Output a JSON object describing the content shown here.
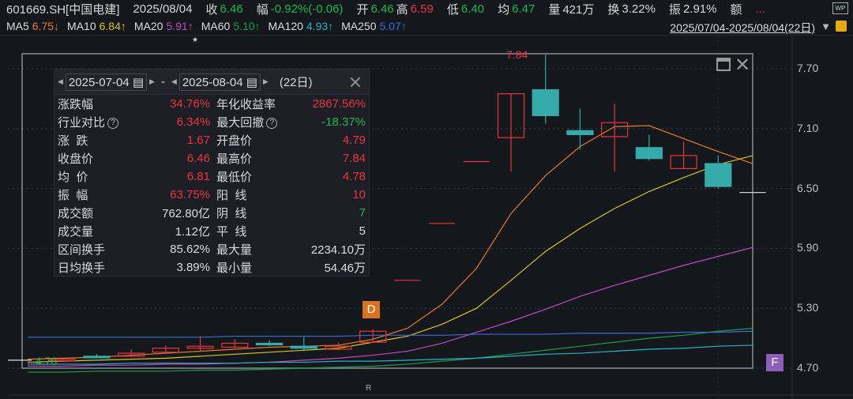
{
  "header": {
    "code": "601669.SH[中国电建]",
    "date": "2025/08/04",
    "close_label": "收",
    "close": "6.46",
    "chg_label": "幅",
    "chg": "-0.92%(-0.06)",
    "open_label": "开",
    "open": "6.46",
    "high_label": "高",
    "high": "6.59",
    "low_label": "低",
    "low": "6.40",
    "avg_label": "均",
    "avg": "6.47",
    "vol_label": "量",
    "vol": "421万",
    "turn_label": "换",
    "turn": "3.22%",
    "amp_label": "振",
    "amp": "2.91%",
    "amt_label": "额",
    "amt": "...",
    "wp_icon": "WP"
  },
  "ma_bar": [
    {
      "label": "MA5",
      "value": "6.75↓",
      "color": "#e8782a"
    },
    {
      "label": "MA10",
      "value": "6.84↑",
      "color": "#d8c22a"
    },
    {
      "label": "MA20",
      "value": "5.91↑",
      "color": "#c04ac0"
    },
    {
      "label": "MA60",
      "value": "5.10↑",
      "color": "#1f9a4a"
    },
    {
      "label": "MA120",
      "value": "4.93↑",
      "color": "#2ab0c8"
    },
    {
      "label": "MA250",
      "value": "5.07↑",
      "color": "#3a6ad8"
    }
  ],
  "range_label": "2025/07/04-2025/08/04(22日)",
  "panel": {
    "start": "2025-07-04",
    "sep": "-",
    "end": "2025-08-04",
    "days": "(22日)",
    "rows": [
      {
        "k": "涨跌幅",
        "v": "34.76%",
        "vc": "red",
        "k2": "年化收益率",
        "v2": "2867.56%",
        "v2c": "red"
      },
      {
        "k": "行业对比",
        "help": true,
        "v": "6.34%",
        "vc": "red",
        "k2": "最大回撤",
        "help2": true,
        "v2": "-18.37%",
        "v2c": "green"
      },
      {
        "k": "涨  跌",
        "v": "1.67",
        "vc": "red",
        "k2": "开盘价",
        "v2": "4.79",
        "v2c": "red"
      },
      {
        "k": "收盘价",
        "v": "6.46",
        "vc": "red",
        "k2": "最高价",
        "v2": "7.84",
        "v2c": "red"
      },
      {
        "k": "均  价",
        "v": "6.81",
        "vc": "red",
        "k2": "最低价",
        "v2": "4.78",
        "v2c": "red"
      },
      {
        "k": "振  幅",
        "v": "63.75%",
        "vc": "red",
        "k2": "阳  线",
        "v2": "10",
        "v2c": "red"
      },
      {
        "k": "成交额",
        "v": "762.80亿",
        "vc": "white",
        "k2": "阴  线",
        "v2": "7",
        "v2c": "green"
      },
      {
        "k": "成交量",
        "v": "1.12亿",
        "vc": "white",
        "k2": "平  线",
        "v2": "5",
        "v2c": "white"
      },
      {
        "k": "区间换手",
        "v": "85.62%",
        "vc": "white",
        "k2": "最大量",
        "v2": "2234.10万",
        "v2c": "white"
      },
      {
        "k": "日均换手",
        "v": "3.89%",
        "vc": "white",
        "k2": "最小量",
        "v2": "54.46万",
        "v2c": "white"
      }
    ]
  },
  "markers": {
    "high_label": "7.84",
    "low_label": "4.78",
    "d_badge": "D",
    "f_badge": "F",
    "r_mark": "R",
    "star": "★"
  },
  "chart_data": {
    "type": "candlestick",
    "yticks": [
      "7.70",
      "7.10",
      "6.50",
      "5.90",
      "5.30",
      "4.70"
    ],
    "ylim": [
      4.7,
      7.7
    ],
    "up_color": "#e8363c",
    "down_color": "#35aaaa",
    "ohlc": [
      [
        4.79,
        4.8,
        4.78,
        4.79
      ],
      [
        4.82,
        4.84,
        4.8,
        4.81
      ],
      [
        4.82,
        4.89,
        4.81,
        4.85
      ],
      [
        4.86,
        4.93,
        4.85,
        4.9
      ],
      [
        4.9,
        5.02,
        4.87,
        4.92
      ],
      [
        4.91,
        4.99,
        4.9,
        4.95
      ],
      [
        4.95,
        4.98,
        4.92,
        4.94
      ],
      [
        4.92,
        5.01,
        4.87,
        4.9
      ],
      [
        4.89,
        4.96,
        4.88,
        4.92
      ],
      [
        4.96,
        5.09,
        4.96,
        5.07
      ],
      [
        5.58,
        5.58,
        5.58,
        5.58
      ],
      [
        6.15,
        6.15,
        6.15,
        6.15
      ],
      [
        6.77,
        6.77,
        6.77,
        6.77
      ],
      [
        7.01,
        7.45,
        6.67,
        7.45
      ],
      [
        7.49,
        7.84,
        7.15,
        7.23
      ],
      [
        7.08,
        7.3,
        6.89,
        7.04
      ],
      [
        7.02,
        7.35,
        6.67,
        7.16
      ],
      [
        6.91,
        7.04,
        6.78,
        6.8
      ],
      [
        6.7,
        6.97,
        6.7,
        6.83
      ],
      [
        6.75,
        6.83,
        6.5,
        6.52
      ],
      [
        6.46,
        6.46,
        6.46,
        6.46
      ]
    ],
    "ma": {
      "MA5": [
        4.79,
        4.8,
        4.81,
        4.83,
        4.85,
        4.87,
        4.89,
        4.91,
        4.92,
        4.93,
        4.99,
        5.1,
        5.34,
        5.7,
        6.25,
        6.63,
        6.92,
        7.12,
        7.13,
        7.0,
        6.87,
        6.75
      ],
      "MA10": [
        4.76,
        4.77,
        4.78,
        4.79,
        4.8,
        4.82,
        4.84,
        4.86,
        4.88,
        4.9,
        4.96,
        5.02,
        5.14,
        5.3,
        5.58,
        5.87,
        6.1,
        6.3,
        6.47,
        6.61,
        6.74,
        6.83
      ],
      "MA20": [
        4.72,
        4.72,
        4.73,
        4.73,
        4.74,
        4.74,
        4.75,
        4.76,
        4.78,
        4.8,
        4.83,
        4.87,
        4.95,
        5.06,
        5.17,
        5.29,
        5.42,
        5.53,
        5.63,
        5.73,
        5.82,
        5.91
      ],
      "MA60": [
        4.66,
        4.66,
        4.67,
        4.67,
        4.67,
        4.68,
        4.68,
        4.69,
        4.7,
        4.71,
        4.72,
        4.74,
        4.77,
        4.8,
        4.84,
        4.88,
        4.92,
        4.96,
        5.0,
        5.03,
        5.07,
        5.1
      ],
      "MA120": [
        4.74,
        4.74,
        4.74,
        4.75,
        4.75,
        4.75,
        4.75,
        4.76,
        4.76,
        4.77,
        4.77,
        4.78,
        4.79,
        4.8,
        4.82,
        4.84,
        4.85,
        4.87,
        4.89,
        4.9,
        4.92,
        4.93
      ],
      "MA250": [
        5.01,
        5.01,
        5.01,
        5.01,
        5.01,
        5.01,
        5.02,
        5.02,
        5.02,
        5.02,
        5.03,
        5.03,
        5.03,
        5.04,
        5.04,
        5.04,
        5.05,
        5.05,
        5.05,
        5.06,
        5.06,
        5.07
      ]
    }
  }
}
